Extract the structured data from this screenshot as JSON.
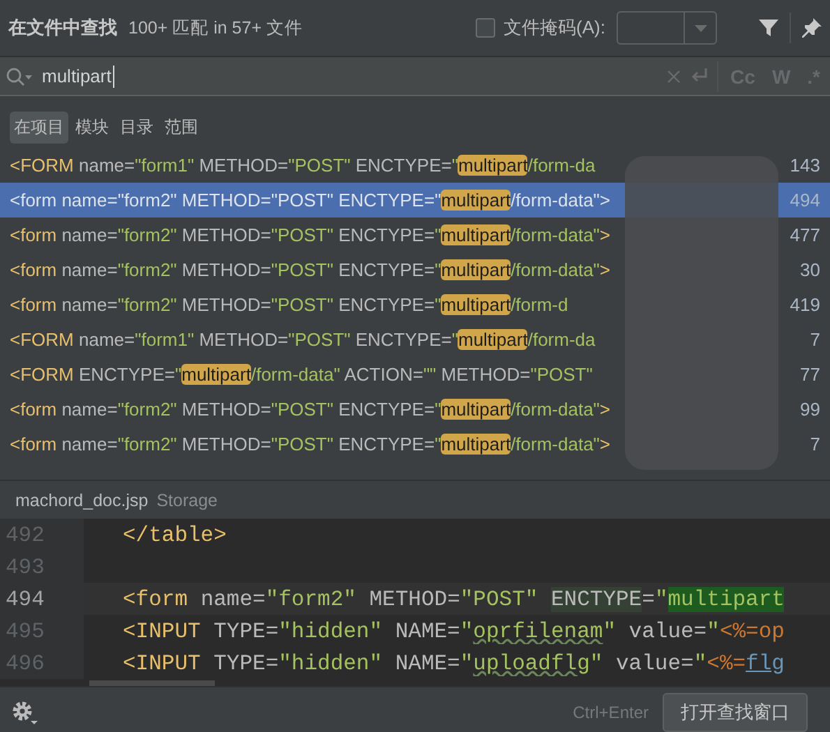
{
  "header": {
    "title": "在文件中查找",
    "summary": "100+ 匹配 in 57+ 文件",
    "file_mask": {
      "label": "文件掩码(A):",
      "checked": false
    }
  },
  "search": {
    "value": "multipart",
    "options": [
      "Cc",
      "W",
      ".*"
    ]
  },
  "scopes": [
    {
      "label": "在项目",
      "selected": true
    },
    {
      "label": "模块",
      "selected": false
    },
    {
      "label": "目录",
      "selected": false
    },
    {
      "label": "范围",
      "selected": false
    }
  ],
  "results": [
    {
      "selected": false,
      "line": "143",
      "code": [
        {
          "kind": "tag",
          "text": "<FORM"
        },
        {
          "kind": "attr",
          "text": " name="
        },
        {
          "kind": "str",
          "text": "\"form1\""
        },
        {
          "kind": "attr",
          "text": " METHOD="
        },
        {
          "kind": "str",
          "text": "\"POST\""
        },
        {
          "kind": "attr",
          "text": " ENCTYPE="
        },
        {
          "kind": "str",
          "text": "\""
        },
        {
          "kind": "match",
          "text": "multipart"
        },
        {
          "kind": "str",
          "text": "/form-da"
        }
      ]
    },
    {
      "selected": true,
      "line": "494",
      "code": [
        {
          "kind": "tag",
          "text": "<form"
        },
        {
          "kind": "attr",
          "text": " name="
        },
        {
          "kind": "str",
          "text": "\"form2\""
        },
        {
          "kind": "attr",
          "text": " METHOD="
        },
        {
          "kind": "str",
          "text": "\"POST\""
        },
        {
          "kind": "attr",
          "text": " ENCTYPE="
        },
        {
          "kind": "str",
          "text": "\""
        },
        {
          "kind": "match",
          "text": "multipart"
        },
        {
          "kind": "str",
          "text": "/form-data\""
        },
        {
          "kind": "tag",
          "text": ">"
        }
      ]
    },
    {
      "selected": false,
      "line": "477",
      "code": [
        {
          "kind": "tag",
          "text": "<form"
        },
        {
          "kind": "attr",
          "text": " name="
        },
        {
          "kind": "str",
          "text": "\"form2\""
        },
        {
          "kind": "attr",
          "text": " METHOD="
        },
        {
          "kind": "str",
          "text": "\"POST\""
        },
        {
          "kind": "attr",
          "text": " ENCTYPE="
        },
        {
          "kind": "str",
          "text": "\""
        },
        {
          "kind": "match",
          "text": "multipart"
        },
        {
          "kind": "str",
          "text": "/form-data\""
        },
        {
          "kind": "tag",
          "text": ">"
        }
      ]
    },
    {
      "selected": false,
      "line": "30",
      "code": [
        {
          "kind": "tag",
          "text": "<form"
        },
        {
          "kind": "attr",
          "text": " name="
        },
        {
          "kind": "str",
          "text": "\"form2\""
        },
        {
          "kind": "attr",
          "text": " METHOD="
        },
        {
          "kind": "str",
          "text": "\"POST\""
        },
        {
          "kind": "attr",
          "text": " ENCTYPE="
        },
        {
          "kind": "str",
          "text": "\""
        },
        {
          "kind": "match",
          "text": "multipart"
        },
        {
          "kind": "str",
          "text": "/form-data\""
        },
        {
          "kind": "tag",
          "text": ">"
        }
      ]
    },
    {
      "selected": false,
      "line": "419",
      "code": [
        {
          "kind": "tag",
          "text": "<form"
        },
        {
          "kind": "attr",
          "text": " name="
        },
        {
          "kind": "str",
          "text": "\"form2\""
        },
        {
          "kind": "attr",
          "text": " METHOD="
        },
        {
          "kind": "str",
          "text": "\"POST\""
        },
        {
          "kind": "attr",
          "text": " ENCTYPE="
        },
        {
          "kind": "str",
          "text": "\""
        },
        {
          "kind": "match",
          "text": "multipart"
        },
        {
          "kind": "str",
          "text": "/form-d"
        }
      ]
    },
    {
      "selected": false,
      "line": "7",
      "code": [
        {
          "kind": "tag",
          "text": "<FORM"
        },
        {
          "kind": "attr",
          "text": " name="
        },
        {
          "kind": "str",
          "text": "\"form1\""
        },
        {
          "kind": "attr",
          "text": " METHOD="
        },
        {
          "kind": "str",
          "text": "\"POST\""
        },
        {
          "kind": "attr",
          "text": " ENCTYPE="
        },
        {
          "kind": "str",
          "text": "\""
        },
        {
          "kind": "match",
          "text": "multipart"
        },
        {
          "kind": "str",
          "text": "/form-da"
        }
      ]
    },
    {
      "selected": false,
      "line": "77",
      "code": [
        {
          "kind": "tag",
          "text": "<FORM"
        },
        {
          "kind": "attr",
          "text": " ENCTYPE="
        },
        {
          "kind": "str",
          "text": "\""
        },
        {
          "kind": "match",
          "text": "multipart"
        },
        {
          "kind": "str",
          "text": "/form-data\""
        },
        {
          "kind": "attr",
          "text": " ACTION="
        },
        {
          "kind": "str",
          "text": "\"\""
        },
        {
          "kind": "attr",
          "text": " METHOD="
        },
        {
          "kind": "str",
          "text": "\"POST\""
        }
      ]
    },
    {
      "selected": false,
      "line": "99",
      "code": [
        {
          "kind": "tag",
          "text": "<form"
        },
        {
          "kind": "attr",
          "text": " name="
        },
        {
          "kind": "str",
          "text": "\"form2\""
        },
        {
          "kind": "attr",
          "text": " METHOD="
        },
        {
          "kind": "str",
          "text": "\"POST\""
        },
        {
          "kind": "attr",
          "text": " ENCTYPE="
        },
        {
          "kind": "str",
          "text": "\""
        },
        {
          "kind": "match",
          "text": "multipart"
        },
        {
          "kind": "str",
          "text": "/form-data\""
        },
        {
          "kind": "tag",
          "text": ">"
        }
      ]
    },
    {
      "selected": false,
      "line": "7",
      "code": [
        {
          "kind": "tag",
          "text": "<form"
        },
        {
          "kind": "attr",
          "text": " name="
        },
        {
          "kind": "str",
          "text": "\"form2\""
        },
        {
          "kind": "attr",
          "text": " METHOD="
        },
        {
          "kind": "str",
          "text": "\"POST\""
        },
        {
          "kind": "attr",
          "text": " ENCTYPE="
        },
        {
          "kind": "str",
          "text": "\""
        },
        {
          "kind": "match",
          "text": "multipart"
        },
        {
          "kind": "str",
          "text": "/form-data\""
        },
        {
          "kind": "tag",
          "text": ">"
        }
      ]
    }
  ],
  "preview": {
    "file": "machord_doc.jsp",
    "location": "Storage"
  },
  "editor": [
    {
      "number": "492",
      "current": false,
      "code": [
        {
          "kind": "tag",
          "text": "</table>"
        }
      ]
    },
    {
      "number": "493",
      "current": false
    },
    {
      "number": "494",
      "current": true,
      "code": [
        {
          "kind": "tag",
          "text": "<form"
        },
        {
          "kind": "attr",
          "text": " name="
        },
        {
          "kind": "str",
          "text": "\"form2\""
        },
        {
          "kind": "attr",
          "text": " METHOD="
        },
        {
          "kind": "str",
          "text": "\"POST\" "
        },
        {
          "kind": "attrhl",
          "text": "ENCTYPE"
        },
        {
          "kind": "attr",
          "text": "="
        },
        {
          "kind": "str",
          "text": "\""
        },
        {
          "kind": "matchhl",
          "text": "multipart"
        }
      ]
    },
    {
      "number": "495",
      "current": false,
      "code": [
        {
          "kind": "tag",
          "text": "<INPUT"
        },
        {
          "kind": "attr",
          "text": " TYPE="
        },
        {
          "kind": "str",
          "text": "\"hidden\""
        },
        {
          "kind": "attr",
          "text": " NAME="
        },
        {
          "kind": "str",
          "text": "\""
        },
        {
          "kind": "typo",
          "text": "oprfilenam"
        },
        {
          "kind": "str",
          "text": "\""
        },
        {
          "kind": "attr",
          "text": " value="
        },
        {
          "kind": "str",
          "text": "\""
        },
        {
          "kind": "jsp",
          "text": "<%="
        },
        {
          "kind": "ident",
          "text": "op"
        }
      ]
    },
    {
      "number": "496",
      "current": false,
      "code": [
        {
          "kind": "tag",
          "text": "<INPUT"
        },
        {
          "kind": "attr",
          "text": " TYPE="
        },
        {
          "kind": "str",
          "text": "\"hidden\""
        },
        {
          "kind": "attr",
          "text": " NAME="
        },
        {
          "kind": "str",
          "text": "\""
        },
        {
          "kind": "typo",
          "text": "uploadflg"
        },
        {
          "kind": "str",
          "text": "\""
        },
        {
          "kind": "attr",
          "text": " value="
        },
        {
          "kind": "str",
          "text": "\""
        },
        {
          "kind": "jsp",
          "text": "<%="
        },
        {
          "kind": "link",
          "text": "flg"
        }
      ]
    }
  ],
  "footer": {
    "shortcut": "Ctrl+Enter",
    "open_button": "打开查找窗口"
  }
}
